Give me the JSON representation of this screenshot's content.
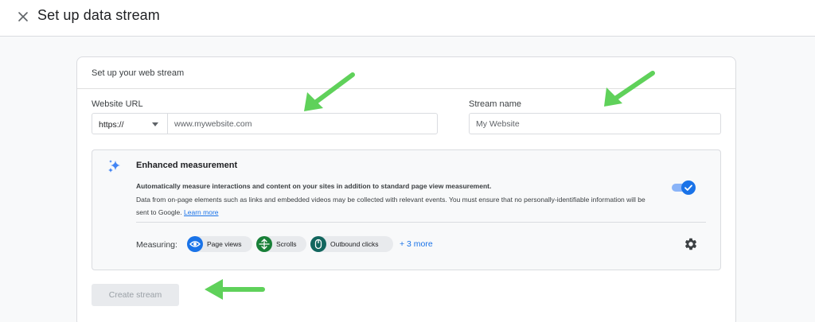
{
  "header": {
    "title": "Set up data stream",
    "close_icon": "close-icon"
  },
  "card": {
    "title": "Set up your web stream"
  },
  "website_url": {
    "label": "Website URL",
    "protocol_value": "https://",
    "placeholder": "www.mywebsite.com"
  },
  "stream_name": {
    "label": "Stream name",
    "placeholder": "My Website"
  },
  "enhanced_measurement": {
    "icon": "sparkle-icon",
    "title": "Enhanced measurement",
    "description_bold": "Automatically measure interactions and content on your sites in addition to standard page view measurement.",
    "description": "Data from on-page elements such as links and embedded videos may be collected with relevant events. You must ensure that no personally-identifiable information will be sent to Google.",
    "learn_more": "Learn more",
    "enabled": true
  },
  "measuring": {
    "label": "Measuring:",
    "chips": [
      {
        "label": "Page views",
        "icon": "eye-icon",
        "color": "#1a73e8"
      },
      {
        "label": "Scrolls",
        "icon": "scroll-icon",
        "color": "#188038"
      },
      {
        "label": "Outbound clicks",
        "icon": "mouse-icon",
        "color": "#12665e"
      }
    ],
    "more": "+ 3 more",
    "settings_icon": "gear-icon"
  },
  "actions": {
    "create_label": "Create stream"
  },
  "annotation_color": "#5fd15a"
}
